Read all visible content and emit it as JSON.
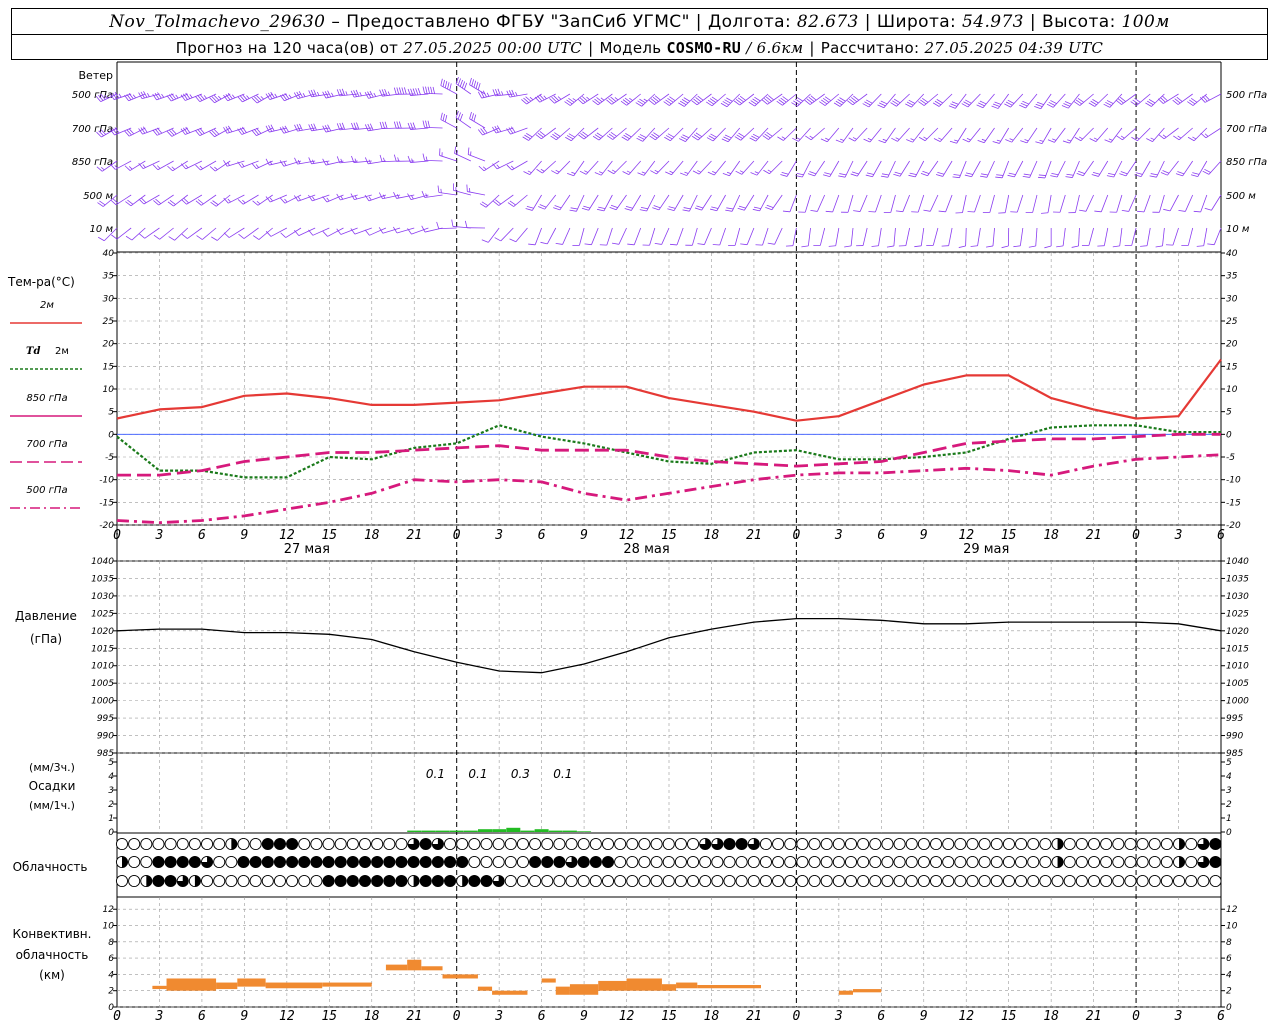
{
  "header": {
    "station": "Nov_Tolmachevo_29630",
    "dash": "–",
    "provider": "Предоставлено ФГБУ \"ЗапСиб УГМС\"",
    "lon_label": "Долгота:",
    "lon": "82.673",
    "lat_label": "Широта:",
    "lat": "54.973",
    "alt_label": "Высота:",
    "alt": "100м",
    "forecast_label": "Прогноз на 120 часа(ов) от",
    "forecast_from": "27.05.2025 00:00 UTC",
    "model_label": "Модель",
    "model": "COSMO-RU",
    "resolution": "/ 6.6км",
    "calc_label": "Рассчитано:",
    "calc_time": "27.05.2025 04:39 UTC"
  },
  "time_axis": {
    "hour_labels": [
      "0",
      "3",
      "6",
      "9",
      "12",
      "15",
      "18",
      "21",
      "0",
      "3",
      "6",
      "9",
      "12",
      "15",
      "18",
      "21",
      "0",
      "3",
      "6",
      "9",
      "12",
      "15",
      "18",
      "21",
      "0",
      "3",
      "6"
    ],
    "day_labels": [
      "27 мая",
      "28 мая",
      "29 мая"
    ]
  },
  "wind_panel": {
    "title": "Ветер",
    "levels": [
      "500 гПа",
      "700 гПа",
      "850 гПа",
      "500 м",
      "10 м"
    ]
  },
  "temp_panel": {
    "title": "Тем-ра(°C)",
    "legend": [
      {
        "label": "2м",
        "color": "#e53935",
        "style": "solid"
      },
      {
        "label": "2м",
        "prefix": "Td",
        "color": "#1a7a1a",
        "style": "dot"
      },
      {
        "label": "850 гПа",
        "color": "#d6197c",
        "style": "solid"
      },
      {
        "label": "700 гПа",
        "color": "#d6197c",
        "style": "dash"
      },
      {
        "label": "500 гПа",
        "color": "#d6197c",
        "style": "dashdot"
      }
    ],
    "y_ticks": [
      "40",
      "35",
      "30",
      "25",
      "20",
      "15",
      "10",
      "5",
      "0",
      "-5",
      "-10",
      "-15",
      "-20"
    ]
  },
  "pressure_panel": {
    "title_line1": "Давление",
    "title_line2": "(гПа)",
    "y_ticks": [
      "1040",
      "1035",
      "1030",
      "1025",
      "1020",
      "1015",
      "1010",
      "1005",
      "1000",
      "995",
      "990",
      "985"
    ]
  },
  "precip_panel": {
    "title_line1": "(мм/3ч.)",
    "title_line2": "Осадки",
    "title_line3": "(мм/1ч.)",
    "y_ticks": [
      "5",
      "4",
      "3",
      "2",
      "1",
      "0"
    ],
    "labels": [
      "0.1",
      "0.1",
      "0.3",
      "0.1"
    ]
  },
  "cloud_panel": {
    "title": "Облачность"
  },
  "conv_panel": {
    "title_line1": "Конвективн.",
    "title_line2": "облачность",
    "title_line3": "(км)",
    "y_ticks": [
      "12",
      "10",
      "8",
      "6",
      "4",
      "2",
      "0"
    ]
  },
  "colors": {
    "wind": "#8a3cf0",
    "t2m": "#e53935",
    "td": "#1a7a1a",
    "upper": "#d6197c",
    "zero_line": "#3355ff",
    "precip": "#22bb22",
    "conv": "#f08a30",
    "grid": "#9a9a9a"
  },
  "chart_data": [
    {
      "type": "line",
      "title": "Тем-ра(°C)",
      "x_hours": [
        0,
        3,
        6,
        9,
        12,
        15,
        18,
        21,
        24,
        27,
        30,
        33,
        36,
        39,
        42,
        45,
        48,
        51,
        54,
        57,
        60,
        63,
        66,
        69,
        72,
        75,
        78
      ],
      "ylim": [
        -20,
        40
      ],
      "series": [
        {
          "name": "2м",
          "values": [
            3.5,
            5.5,
            6,
            8.5,
            9,
            8,
            6.5,
            6.5,
            7,
            7.5,
            9,
            10.5,
            10.5,
            8,
            6.5,
            5,
            3,
            4,
            7.5,
            11,
            13,
            13,
            8,
            5.5,
            3.5,
            4,
            16.5
          ]
        },
        {
          "name": "Td 2м",
          "values": [
            -0.5,
            -8,
            -8,
            -9.5,
            -9.5,
            -5,
            -5.5,
            -3,
            -2,
            2,
            -0.5,
            -2,
            -4,
            -6,
            -6.5,
            -4,
            -3.5,
            -5.5,
            -5.5,
            -5,
            -4,
            -1,
            1.5,
            2,
            2,
            0.5,
            0.5
          ]
        },
        {
          "name": "850 гПа",
          "values": [
            -9,
            -9,
            -8,
            -6,
            -5,
            -4,
            -4,
            -3.5,
            -3,
            -2.5,
            -3.5,
            -3.5,
            -3.5,
            -5,
            -6,
            -6.5,
            -7,
            -6.5,
            -6,
            -4,
            -2,
            -1.5,
            -1,
            -1,
            -0.5,
            0,
            0
          ]
        },
        {
          "name": "700 гПа",
          "values": [
            -19,
            -19.5,
            -19,
            -18,
            -16.5,
            -15,
            -13,
            -10,
            -10.5,
            -10,
            -10.5,
            -13,
            -14.5,
            -13,
            -11.5,
            -10,
            -9,
            -8.5,
            -8.5,
            -8,
            -7.5,
            -8,
            -9,
            -7,
            -5.5,
            -5,
            -4.5
          ]
        }
      ]
    },
    {
      "type": "line",
      "title": "Давление (гПа)",
      "x_hours": [
        0,
        3,
        6,
        9,
        12,
        15,
        18,
        21,
        24,
        27,
        30,
        33,
        36,
        39,
        42,
        45,
        48,
        51,
        54,
        57,
        60,
        63,
        66,
        69,
        72,
        75,
        78
      ],
      "ylim": [
        985,
        1040
      ],
      "series": [
        {
          "name": "Давление",
          "values": [
            1020,
            1020.5,
            1020.5,
            1019.5,
            1019.5,
            1019,
            1017.5,
            1014,
            1011,
            1008.5,
            1008,
            1010.5,
            1014,
            1018,
            1020.5,
            1022.5,
            1023.5,
            1023.5,
            1023,
            1022,
            1022,
            1022.5,
            1022.5,
            1022.5,
            1022.5,
            1022,
            1020
          ]
        }
      ]
    },
    {
      "type": "bar",
      "title": "Осадки (мм/3ч.) (мм/1ч.)",
      "ylim": [
        0,
        5
      ],
      "labels_3h": [
        {
          "hour": 22.5,
          "value": 0.1
        },
        {
          "hour": 25.5,
          "value": 0.1
        },
        {
          "hour": 28.5,
          "value": 0.3
        },
        {
          "hour": 31.5,
          "value": 0.1
        }
      ],
      "bars_1h": {
        "hours": [
          21,
          22,
          23,
          24,
          25,
          26,
          27,
          28,
          29,
          30,
          31,
          32,
          33
        ],
        "values": [
          0.1,
          0.1,
          0.1,
          0.1,
          0.1,
          0.2,
          0.2,
          0.3,
          0.1,
          0.2,
          0.1,
          0.1,
          0.05
        ]
      }
    },
    {
      "type": "bar",
      "title": "Конвективн. облачность (км)",
      "ylim": [
        0,
        13
      ],
      "segments": [
        {
          "from": 2.5,
          "to": 3.5,
          "bottom": 2.2,
          "top": 2.6
        },
        {
          "from": 3.5,
          "to": 7.0,
          "bottom": 2.0,
          "top": 3.5
        },
        {
          "from": 7.0,
          "to": 8.5,
          "bottom": 2.2,
          "top": 3.0
        },
        {
          "from": 8.5,
          "to": 10.5,
          "bottom": 2.5,
          "top": 3.5
        },
        {
          "from": 10.5,
          "to": 14.5,
          "bottom": 2.3,
          "top": 3.0
        },
        {
          "from": 14.5,
          "to": 18.0,
          "bottom": 2.5,
          "top": 3.0
        },
        {
          "from": 19.0,
          "to": 20.5,
          "bottom": 4.5,
          "top": 5.2
        },
        {
          "from": 20.5,
          "to": 21.5,
          "bottom": 4.5,
          "top": 5.8
        },
        {
          "from": 21.5,
          "to": 23.0,
          "bottom": 4.5,
          "top": 5.0
        },
        {
          "from": 23.0,
          "to": 25.5,
          "bottom": 3.5,
          "top": 4.0
        },
        {
          "from": 25.5,
          "to": 26.5,
          "bottom": 2.0,
          "top": 2.5
        },
        {
          "from": 26.5,
          "to": 29.0,
          "bottom": 1.5,
          "top": 2.0
        },
        {
          "from": 30.0,
          "to": 31.0,
          "bottom": 3.0,
          "top": 3.5
        },
        {
          "from": 31.0,
          "to": 32.0,
          "bottom": 1.5,
          "top": 2.5
        },
        {
          "from": 32.0,
          "to": 34.0,
          "bottom": 1.5,
          "top": 2.8
        },
        {
          "from": 34.0,
          "to": 36.0,
          "bottom": 2.0,
          "top": 3.2
        },
        {
          "from": 36.0,
          "to": 38.5,
          "bottom": 2.0,
          "top": 3.5
        },
        {
          "from": 38.5,
          "to": 39.5,
          "bottom": 2.0,
          "top": 2.8
        },
        {
          "from": 39.5,
          "to": 41.0,
          "bottom": 2.3,
          "top": 3.0
        },
        {
          "from": 41.0,
          "to": 45.5,
          "bottom": 2.3,
          "top": 2.7
        },
        {
          "from": 51.0,
          "to": 52.0,
          "bottom": 1.5,
          "top": 2.0
        },
        {
          "from": 52.0,
          "to": 54.0,
          "bottom": 1.8,
          "top": 2.2
        }
      ]
    },
    {
      "type": "table",
      "title": "Облачность",
      "layers": [
        "top",
        "middle",
        "bottom"
      ],
      "cover_eighths": {
        "top": [
          0,
          0,
          0,
          0,
          0,
          0,
          0,
          0,
          0,
          0,
          0,
          0,
          0,
          4,
          0,
          0,
          0,
          8,
          6,
          8,
          8,
          0,
          0,
          0,
          0,
          0,
          0,
          0,
          0,
          0,
          0,
          0,
          0,
          0,
          4,
          6,
          8,
          6,
          0,
          0,
          0,
          0,
          0,
          0,
          0,
          0,
          0,
          0,
          0,
          0,
          0,
          0,
          0,
          0,
          0,
          0,
          0,
          0,
          0,
          0,
          0,
          0,
          0,
          0,
          0,
          0,
          0,
          0,
          0,
          6,
          8,
          6,
          8,
          8,
          0,
          6,
          0,
          0,
          0,
          0,
          0,
          0,
          0,
          0,
          0,
          0,
          0,
          0,
          0,
          0,
          0,
          0,
          0,
          0,
          0,
          0,
          0,
          0,
          0,
          0,
          0,
          0,
          0,
          0,
          0,
          0,
          0,
          0,
          0,
          0,
          0,
          4,
          0,
          0,
          0,
          0,
          0,
          0,
          0,
          0,
          0,
          0,
          0,
          0,
          0,
          4,
          4,
          0,
          6,
          4,
          8
        ],
        "middle": [
          4,
          0,
          0,
          0,
          8,
          8,
          8,
          8,
          8,
          8,
          6,
          8,
          0,
          0,
          8,
          8,
          8,
          8,
          8,
          8,
          8,
          8,
          8,
          8,
          8,
          8,
          8,
          8,
          8,
          8,
          8,
          8,
          8,
          8,
          8,
          8,
          8,
          8,
          8,
          8,
          8,
          4,
          0,
          0,
          8,
          0,
          0,
          8,
          0,
          8,
          8,
          8,
          8,
          6,
          8,
          8,
          8,
          8,
          8,
          0,
          0,
          0,
          0,
          0,
          0,
          0,
          0,
          0,
          0,
          0,
          0,
          0,
          0,
          0,
          0,
          0,
          0,
          0,
          0,
          0,
          0,
          0,
          0,
          0,
          0,
          0,
          0,
          0,
          0,
          0,
          0,
          0,
          0,
          0,
          0,
          0,
          0,
          0,
          0,
          0,
          0,
          0,
          0,
          0,
          0,
          0,
          0,
          0,
          0,
          0,
          0,
          4,
          0,
          0,
          0,
          0,
          0,
          0,
          0,
          0,
          0,
          0,
          0,
          0,
          0,
          4,
          4,
          0,
          6,
          4,
          8
        ],
        "bottom": [
          0,
          0,
          0,
          4,
          8,
          8,
          8,
          6,
          8,
          4,
          0,
          0,
          0,
          0,
          0,
          0,
          0,
          0,
          0,
          0,
          0,
          0,
          0,
          0,
          8,
          8,
          8,
          8,
          8,
          8,
          8,
          8,
          8,
          8,
          8,
          4,
          8,
          8,
          8,
          8,
          4,
          0,
          8,
          8,
          0,
          6,
          0,
          8,
          0,
          0,
          0,
          0,
          0,
          0,
          0,
          0,
          0,
          0,
          0,
          0,
          0,
          0,
          0,
          0,
          0,
          0,
          0,
          0,
          0,
          0,
          0,
          0,
          0,
          0,
          0,
          0,
          0,
          0,
          0,
          0,
          0,
          0,
          0,
          0,
          0,
          0,
          0,
          0,
          0,
          0,
          0,
          0,
          0,
          0,
          0,
          0,
          0,
          0,
          0,
          0,
          0,
          0,
          0,
          0,
          0,
          0,
          0,
          0,
          0,
          0,
          0,
          0,
          0,
          0,
          0,
          0,
          0,
          0,
          0,
          0,
          0,
          0,
          0,
          0,
          0,
          0,
          0,
          0,
          0,
          0,
          0
        ]
      }
    },
    {
      "type": "line",
      "title": "Ветер",
      "levels": [
        "500 гПа",
        "700 гПа",
        "850 гПа",
        "500 м",
        "10 м"
      ],
      "speed_ms": {
        "500 гПа": [
          20,
          20,
          20,
          22,
          22,
          22,
          22,
          25,
          25,
          22,
          20,
          20,
          20,
          18,
          18,
          18,
          18,
          18,
          15,
          15,
          15,
          15,
          15,
          15,
          15,
          15,
          15
        ],
        "700 гПа": [
          15,
          15,
          15,
          15,
          15,
          15,
          15,
          15,
          15,
          15,
          15,
          15,
          15,
          15,
          15,
          15,
          12,
          12,
          12,
          12,
          12,
          12,
          12,
          12,
          10,
          10,
          10
        ],
        "850 гПа": [
          10,
          10,
          10,
          10,
          10,
          12,
          12,
          12,
          10,
          10,
          10,
          10,
          10,
          10,
          10,
          10,
          8,
          8,
          8,
          8,
          8,
          8,
          8,
          8,
          8,
          8,
          8
        ],
        "500 м": [
          8,
          8,
          8,
          10,
          10,
          10,
          10,
          10,
          10,
          8,
          8,
          8,
          8,
          8,
          8,
          8,
          6,
          6,
          6,
          6,
          6,
          6,
          6,
          6,
          6,
          6,
          6
        ],
        "10 м": [
          4,
          4,
          4,
          4,
          4,
          4,
          4,
          4,
          4,
          4,
          4,
          4,
          4,
          4,
          4,
          4,
          3,
          3,
          3,
          3,
          3,
          3,
          3,
          3,
          3,
          3,
          3
        ]
      }
    }
  ]
}
